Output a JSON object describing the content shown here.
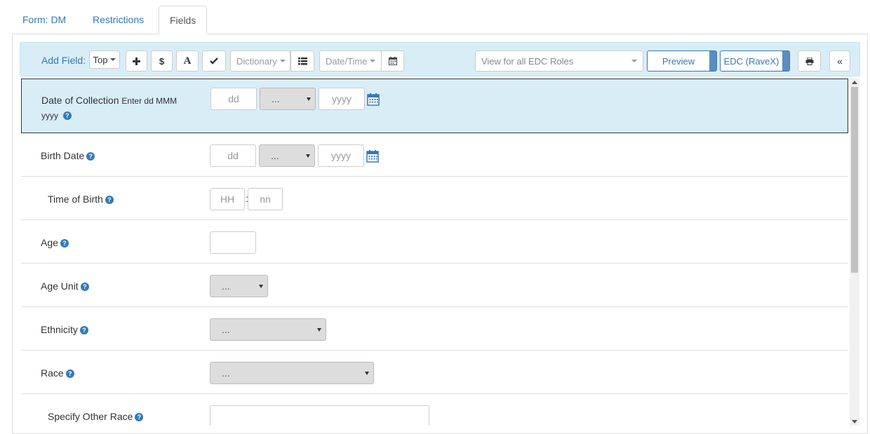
{
  "tabs": [
    {
      "label": "Form: DM"
    },
    {
      "label": "Restrictions"
    },
    {
      "label": "Fields"
    }
  ],
  "toolbar": {
    "add_field_label": "Add Field:",
    "position_select": "Top",
    "add_icon": "plus-icon",
    "dollar_label": "$",
    "text_label": "A",
    "check_icon": "check-icon",
    "dictionary_select": "Dictionary",
    "list_icon": "list-icon",
    "datetime_select": "Date/Time",
    "calendar_icon": "calendar-icon",
    "roles_select": "View for all EDC Roles",
    "preview_label": "Preview",
    "edc_label": "EDC (RaveX)",
    "print_icon": "print-icon",
    "collapse_label": "«"
  },
  "fields": [
    {
      "label": "Date of Collection",
      "hint": "Enter dd MMM yyyy",
      "day": "dd",
      "month": "...",
      "year": "yyyy"
    },
    {
      "label": "Birth Date",
      "day": "dd",
      "month": "...",
      "year": "yyyy"
    },
    {
      "label": "Time of Birth",
      "hour": "HH",
      "sep": ":",
      "minute": "nn"
    },
    {
      "label": "Age"
    },
    {
      "label": "Age Unit",
      "value": "..."
    },
    {
      "label": "Ethnicity",
      "value": "..."
    },
    {
      "label": "Race",
      "value": "..."
    },
    {
      "label": "Specify Other Race"
    }
  ],
  "help_glyph": "?",
  "colors": {
    "accent": "#337ab7",
    "toolbar_bg": "#d9edf7",
    "selected_row_bg": "#d9edf7"
  }
}
